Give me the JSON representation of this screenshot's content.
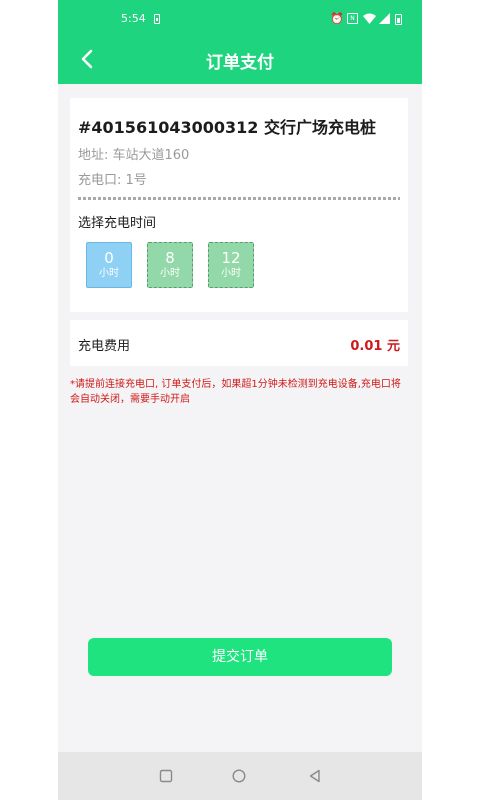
{
  "status_bar": {
    "time": "5:54",
    "icons": [
      "sim-icon",
      "alarm-icon",
      "nfc-icon",
      "wifi-icon",
      "signal-icon",
      "battery-icon"
    ]
  },
  "header": {
    "title": "订单支付",
    "back_icon": "chevron-left-icon"
  },
  "station": {
    "name": "#401561043000312 交行广场充电桩",
    "address": "地址: 车站大道160",
    "port": "充电口: 1号"
  },
  "charge_time": {
    "label": "选择充电时间",
    "options": [
      {
        "value": "0",
        "unit": "小时",
        "selected": true
      },
      {
        "value": "8",
        "unit": "小时",
        "selected": false
      },
      {
        "value": "12",
        "unit": "小时",
        "selected": false
      }
    ]
  },
  "fee": {
    "label": "充电费用",
    "value": "0.01 元"
  },
  "notice": "*请提前连接充电口, 订单支付后，如果超1分钟未检测到充电设备,充电口将会自动关闭，需要手动开启",
  "submit_label": "提交订单",
  "nav": [
    "recent-apps-icon",
    "home-icon",
    "back-icon"
  ],
  "colors": {
    "brand_green": "#1ed47f",
    "button_green": "#1ee37f",
    "selected_blue": "#8fd0f5",
    "unselected_green": "#93d8a8",
    "price_red": "#cf1a1a"
  }
}
